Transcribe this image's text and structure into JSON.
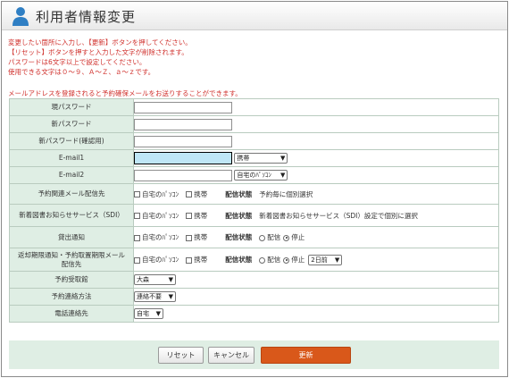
{
  "header": {
    "title": "利用者情報変更"
  },
  "notes": [
    "変更したい箇所に入力し、【更新】ボタンを押してください。",
    "【リセット】ボタンを押すと入力した文字が削除されます。",
    "パスワードは6文字以上で設定してください。",
    "使用できる文字は０～９、Ａ～Ｚ、ａ～ｚです。"
  ],
  "email_note": "メールアドレスを登録されると予約確保メールをお送りすることができます。",
  "fields": {
    "current_password": {
      "label": "現パスワード",
      "value": ""
    },
    "new_password": {
      "label": "新パスワード",
      "value": ""
    },
    "confirm_password": {
      "label": "新パスワード(確認用)",
      "value": ""
    },
    "email1": {
      "label": "E-mail1",
      "value": "",
      "select": "携帯"
    },
    "email2": {
      "label": "E-mail2",
      "value": "",
      "select": "自宅のﾊﾟｿｺﾝ"
    },
    "reservation_mail": {
      "label": "予約関連メール配信先",
      "opt1": "自宅のﾊﾟｿｺﾝ",
      "opt2": "携帯",
      "status_label": "配信状態",
      "status_text": "予約毎に個別選択"
    },
    "sdi": {
      "label": "新着図書お知らせサービス（SDI）",
      "opt1": "自宅のﾊﾟｿｺﾝ",
      "opt2": "携帯",
      "status_label": "配信状態",
      "status_text": "新着図書お知らせサービス（SDI）設定で個別に選択"
    },
    "loan_notice": {
      "label": "貸出通知",
      "opt1": "自宅のﾊﾟｿｺﾝ",
      "opt2": "携帯",
      "status_label": "配信状態",
      "radio1": "配信",
      "radio2": "停止",
      "selected": "停止"
    },
    "return_notice": {
      "label_line1": "返却期限通知・予約取置期限メール",
      "label_line2": "配信先",
      "opt1": "自宅のﾊﾟｿｺﾝ",
      "opt2": "携帯",
      "status_label": "配信状態",
      "radio1": "配信",
      "radio2": "停止",
      "selected": "停止",
      "select": "2日前"
    },
    "pickup_library": {
      "label": "予約受取館",
      "select": "大森"
    },
    "contact_method": {
      "label": "予約連絡方法",
      "select": "連絡不要"
    },
    "phone_contact": {
      "label": "電話連絡先",
      "select": "自宅"
    }
  },
  "buttons": {
    "reset": "リセット",
    "cancel": "キャンセル",
    "update": "更新"
  },
  "colors": {
    "label_bg": "#dfeee4",
    "notice_red": "#d0312d",
    "update_btn": "#d9581a",
    "email_highlight": "#bfe6f6"
  }
}
